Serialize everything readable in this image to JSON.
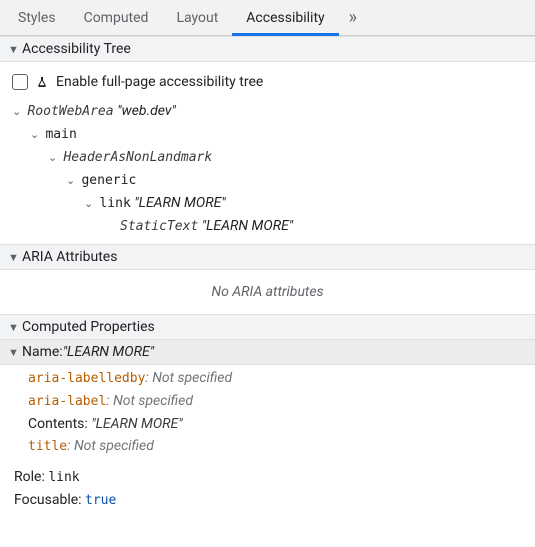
{
  "tabs": {
    "items": [
      "Styles",
      "Computed",
      "Layout",
      "Accessibility"
    ],
    "active_index": 3,
    "overflow": "»"
  },
  "sections": {
    "tree_header": "Accessibility Tree",
    "enable_label": "Enable full-page accessibility tree",
    "aria_header": "ARIA Attributes",
    "no_aria": "No ARIA attributes",
    "computed_header": "Computed Properties"
  },
  "tree": {
    "n0_role": "RootWebArea",
    "n0_name": "\"web.dev\"",
    "n1_role": "main",
    "n2_role": "HeaderAsNonLandmark",
    "n3_role": "generic",
    "n4_role": "link",
    "n4_name": "\"LEARN MORE\"",
    "n5_role": "StaticText",
    "n5_name": "\"LEARN MORE\""
  },
  "computed": {
    "name_label": "Name: ",
    "name_value": "\"LEARN MORE\"",
    "aria_labelledby_k": "aria-labelledby",
    "aria_label_k": "aria-label",
    "contents_k": "Contents",
    "contents_v": "\"LEARN MORE\"",
    "title_k": "title",
    "not_spec": "Not specified",
    "role_label": "Role: ",
    "role_value": "link",
    "focusable_label": "Focusable: ",
    "focusable_value": "true",
    "colon": ": "
  }
}
